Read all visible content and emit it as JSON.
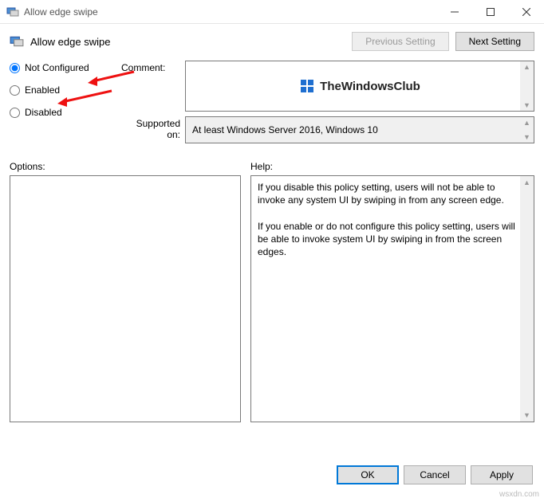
{
  "window": {
    "title": "Allow edge swipe",
    "policy_name": "Allow edge swipe"
  },
  "nav": {
    "prev": "Previous Setting",
    "next": "Next Setting"
  },
  "radios": {
    "not_configured": "Not Configured",
    "enabled": "Enabled",
    "disabled": "Disabled",
    "selected": "not_configured"
  },
  "labels": {
    "comment": "Comment:",
    "supported": "Supported on:",
    "options": "Options:",
    "help": "Help:"
  },
  "supported_text": "At least Windows Server 2016, Windows 10",
  "comment_logo_text": "TheWindowsClub",
  "help_text": {
    "p1": "If you disable this policy setting, users will not be able to invoke any system UI by swiping in from any screen edge.",
    "p2": "If you enable or do not configure this policy setting, users will be able to invoke system UI by swiping in from the screen edges."
  },
  "buttons": {
    "ok": "OK",
    "cancel": "Cancel",
    "apply": "Apply"
  },
  "watermark": "wsxdn.com"
}
